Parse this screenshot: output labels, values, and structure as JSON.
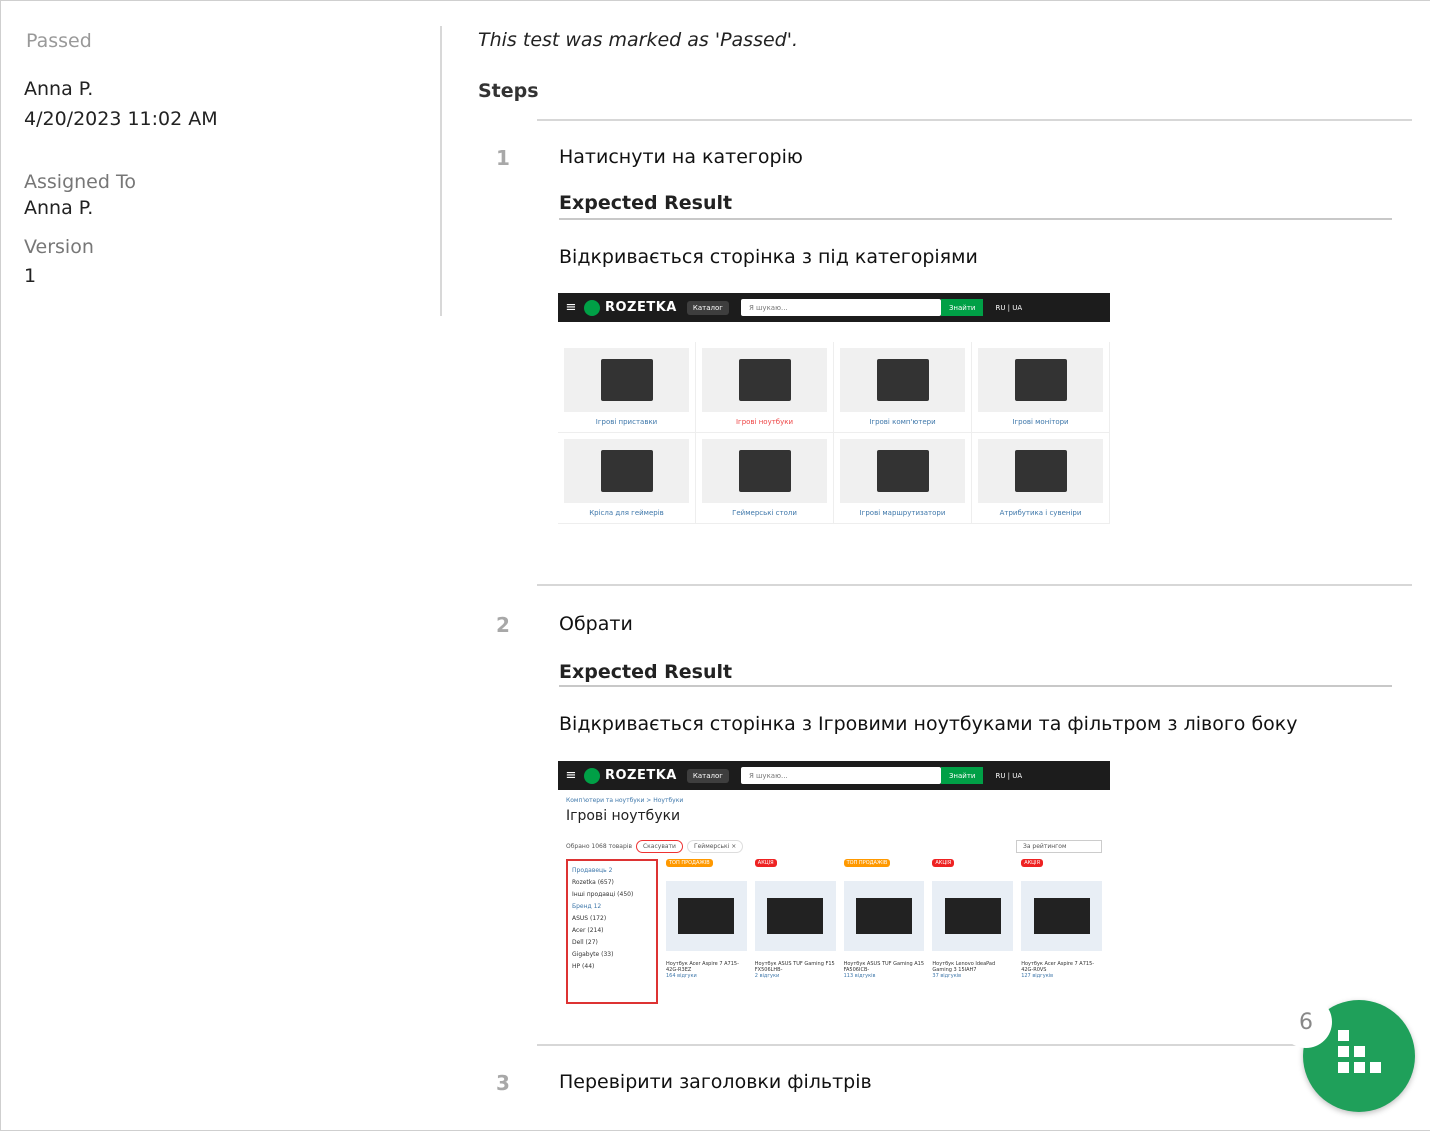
{
  "sidebar": {
    "status": "Passed",
    "user": "Anna P.",
    "datetime": "4/20/2023 11:02 AM",
    "assigned_label": "Assigned To",
    "assigned_value": "Anna P.",
    "version_label": "Version",
    "version_value": "1"
  },
  "main": {
    "note": "This test was marked as 'Passed'.",
    "steps_heading": "Steps",
    "expected_label": "Expected Result",
    "steps": [
      {
        "num": "1",
        "text": "Натиснути на категорію",
        "expected": "Відкривається сторінка з під категоріями"
      },
      {
        "num": "2",
        "text": "Обрати",
        "expected": "Відкривається сторінка з Ігровими ноутбуками та фільтром з лівого боку"
      },
      {
        "num": "3",
        "text": "Перевірити заголовки фільтрів"
      }
    ]
  },
  "shot1": {
    "logo": "ROZETKA",
    "catalog": "Каталог",
    "search_placeholder": "Я шукаю...",
    "find": "Знайти",
    "lang": "RU | UA",
    "categories": [
      "Ігрові приставки",
      "Ігрові ноутбуки",
      "Ігрові комп'ютери",
      "Ігрові монітори",
      "Крісла для геймерів",
      "Геймерські столи",
      "Ігрові маршрутизатори",
      "Атрибутика і сувеніри"
    ]
  },
  "shot2": {
    "breadcrumb": "Комп'ютери та ноутбуки  >  Ноутбуки",
    "title": "Ігрові ноутбуки",
    "selected": "Обрано 1068 товарів",
    "cancel": "Скасувати",
    "chip": "Геймерські ×",
    "sort": "За рейтингом",
    "filter_lines": [
      "Продавець 2",
      "Rozetka (657)",
      "Інші продавці (450)",
      "Бренд 12",
      "ASUS (172)",
      "Acer (214)",
      "Dell (27)",
      "Gigabyte (33)",
      "HP (44)"
    ],
    "products": [
      {
        "badge": "ТОП ПРОДАЖІВ",
        "name": "Ноутбук Acer Aspire 7 A715-42G-R3EZ",
        "reviews": "164 відгуки"
      },
      {
        "badge": "АКЦІЯ",
        "name": "Ноутбук ASUS TUF Gaming F15 FX506LHB-",
        "reviews": "2 відгуки"
      },
      {
        "badge": "ТОП ПРОДАЖІВ",
        "name": "Ноутбук ASUS TUF Gaming A15 FA506ICB-",
        "reviews": "113 відгуків"
      },
      {
        "badge": "АКЦІЯ",
        "name": "Ноутбук Lenovo IdeaPad Gaming 3 15IAH7",
        "reviews": "37 відгуків"
      },
      {
        "badge": "АКЦІЯ",
        "name": "Ноутбук Acer Aspire 7 A715-42G-R0VS",
        "reviews": "127 відгуків"
      }
    ]
  },
  "fab": {
    "count": "6"
  }
}
